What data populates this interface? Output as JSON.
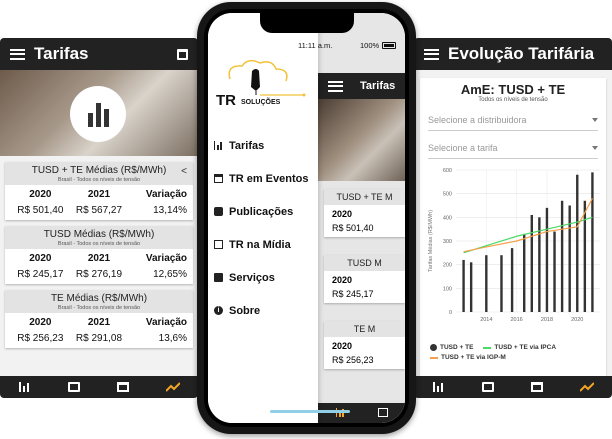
{
  "left": {
    "title": "Tarifas",
    "cards": [
      {
        "title": "TUSD + TE Médias (R$/MWh)",
        "subtitle": "Brasil - Todos os níveis de tensão",
        "share": true,
        "headers": [
          "2020",
          "2021",
          "Variação"
        ],
        "values": [
          "R$ 501,40",
          "R$ 567,27",
          "13,14%"
        ]
      },
      {
        "title": "TUSD Médias (R$/MWh)",
        "subtitle": "Brasil - Todos os níveis de tensão",
        "share": false,
        "headers": [
          "2020",
          "2021",
          "Variação"
        ],
        "values": [
          "R$ 245,17",
          "R$ 276,19",
          "12,65%"
        ]
      },
      {
        "title": "TE Médias (R$/MWh)",
        "subtitle": "Brasil - Todos os níveis de tensão",
        "share": false,
        "headers": [
          "2020",
          "2021",
          "Variação"
        ],
        "values": [
          "R$ 256,23",
          "R$ 291,08",
          "13,6%"
        ]
      }
    ]
  },
  "phone": {
    "time": "11:11 a.m.",
    "battery": "100%",
    "logo_text_a": "TR",
    "logo_text_b": "SOLUÇÕES",
    "menu": [
      {
        "label": "Tarifas",
        "icon": "bar-chart-icon"
      },
      {
        "label": "TR em Eventos",
        "icon": "calendar-icon"
      },
      {
        "label": "Publicações",
        "icon": "bus-icon"
      },
      {
        "label": "TR na Mídia",
        "icon": "newspaper-icon"
      },
      {
        "label": "Serviços",
        "icon": "briefcase-icon"
      },
      {
        "label": "Sobre",
        "icon": "info-icon"
      }
    ],
    "under": {
      "title": "Tarifas",
      "cards": [
        {
          "title": "TUSD + TE M",
          "year": "2020",
          "value": "R$ 501,40"
        },
        {
          "title": "TUSD M",
          "year": "2020",
          "value": "R$ 245,17"
        },
        {
          "title": "TE M",
          "year": "2020",
          "value": "R$ 256,23"
        }
      ]
    }
  },
  "right": {
    "title": "Evolução Tarifária",
    "chart_title": "AmE: TUSD + TE",
    "chart_subtitle": "Todos os níveis de tensão",
    "select_distributor": "Selecione a distribuidora",
    "select_tariff": "Selecione a tarifa",
    "legend": {
      "s1": "TUSD + TE",
      "s2": "TUSD + TE via IPCA",
      "s3": "TUSD + TE via IGP-M"
    },
    "colors": {
      "bars": "#333333",
      "ipca": "#4cd964",
      "igpm": "#f5a04a"
    }
  },
  "chart_data": {
    "type": "bar",
    "ylabel": "Tarifas Médias (R$/MWh)",
    "ylim": [
      0,
      600
    ],
    "yticks": [
      0,
      100,
      200,
      300,
      400,
      500,
      600
    ],
    "xlim": [
      2012,
      2021.5
    ],
    "xticks": [
      2014,
      2016,
      2018,
      2020
    ],
    "series": [
      {
        "name": "TUSD + TE",
        "kind": "bar",
        "x": [
          2012.5,
          2013,
          2014,
          2015,
          2015.7,
          2016.5,
          2017,
          2017.5,
          2018,
          2018.5,
          2019,
          2019.5,
          2020,
          2020.5,
          2021
        ],
        "y": [
          220,
          210,
          240,
          240,
          270,
          330,
          410,
          400,
          440,
          340,
          470,
          450,
          580,
          470,
          590
        ]
      },
      {
        "name": "TUSD + TE via IPCA",
        "kind": "line",
        "x": [
          2012.5,
          2014,
          2016,
          2018,
          2020,
          2021
        ],
        "y": [
          250,
          280,
          320,
          350,
          380,
          400
        ]
      },
      {
        "name": "TUSD + TE via IGP-M",
        "kind": "line",
        "x": [
          2012.5,
          2014,
          2016,
          2018,
          2020,
          2021
        ],
        "y": [
          255,
          275,
          300,
          340,
          360,
          480
        ]
      }
    ]
  }
}
